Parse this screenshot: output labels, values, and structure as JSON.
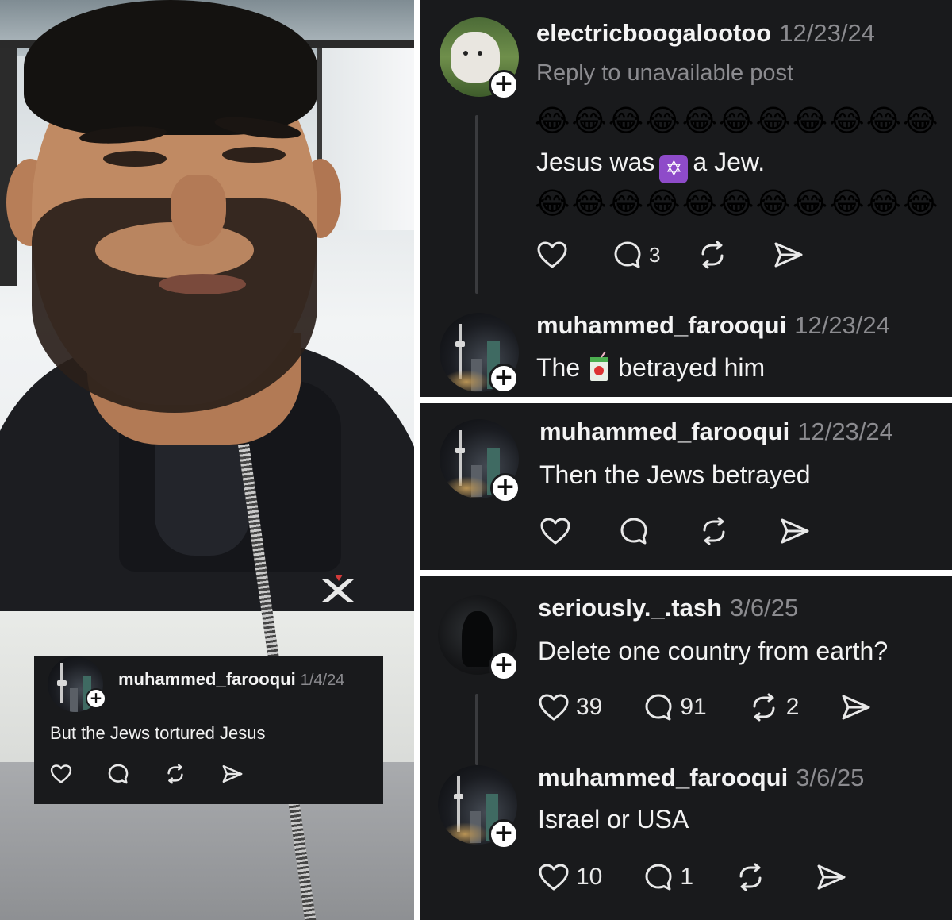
{
  "cards": {
    "post1": {
      "username": "electricboogalootoo",
      "date": "12/23/24",
      "reply_context": "Reply to unavailable post",
      "emoji_row": "😂😂😂😂😂😂😂😂😂😂😂",
      "text_before": "Jesus was",
      "star_emoji": "✡",
      "text_after": "a Jew.",
      "likes": "",
      "replies": "3",
      "reposts": ""
    },
    "post2": {
      "username": "muhammed_farooqui",
      "date": "12/23/24",
      "text_before": "The",
      "text_after": "betrayed him"
    },
    "post3": {
      "username": "muhammed_farooqui",
      "date": "12/23/24",
      "text": "Then the Jews betrayed"
    },
    "post4": {
      "username": "seriously._.tash",
      "date": "3/6/25",
      "text": "Delete one country from earth?",
      "likes": "39",
      "replies": "91",
      "reposts": "2"
    },
    "post5": {
      "username": "muhammed_farooqui",
      "date": "3/6/25",
      "text": "Israel or USA",
      "likes": "10",
      "replies": "1"
    },
    "small": {
      "username": "muhammed_farooqui",
      "date": "1/4/24",
      "text": "But the Jews tortured Jesus"
    }
  },
  "plus_glyph": "+",
  "colors": {
    "card_bg": "#191a1c",
    "text": "#f3f3f3",
    "muted": "#8b8b8f",
    "divider": "#ffffff"
  },
  "icons": [
    "heart-icon",
    "comment-icon",
    "repost-icon",
    "share-icon",
    "plus-icon"
  ]
}
